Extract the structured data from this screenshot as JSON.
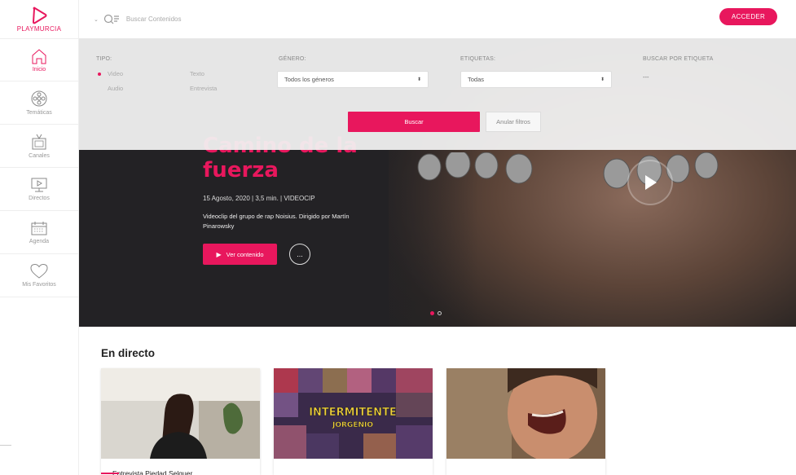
{
  "app": {
    "logo_text": "PLAYMURCIA",
    "brand_color": "#e8175d"
  },
  "sidebar": {
    "items": [
      {
        "label": "Inicio",
        "icon": "home-icon",
        "active": true
      },
      {
        "label": "Temáticas",
        "icon": "film-reel-icon",
        "active": false
      },
      {
        "label": "Canales",
        "icon": "tv-icon",
        "active": false
      },
      {
        "label": "Directos",
        "icon": "live-screen-icon",
        "active": false
      },
      {
        "label": "Agenda",
        "icon": "calendar-icon",
        "active": false
      },
      {
        "label": "Mis Favoritos",
        "icon": "heart-icon",
        "active": false
      }
    ]
  },
  "topbar": {
    "search_placeholder": "Buscar Contenidos",
    "login_label": "ACCEDER"
  },
  "filters": {
    "type_label": "TIPO:",
    "types": [
      {
        "label": "Video",
        "selected": true
      },
      {
        "label": "Texto",
        "selected": false
      },
      {
        "label": "Audio",
        "selected": false
      },
      {
        "label": "Entrevista",
        "selected": false
      }
    ],
    "genre_label": "GÉNERO:",
    "genre_value": "Todos los géneros",
    "tags_label": "ETIQUETAS:",
    "tags_value": "Todas",
    "search_by_tag_label": "BUSCAR POR ETIQUETA",
    "search_by_tag_value": "---",
    "search_button": "Buscar",
    "reset_button": "Anular filtros"
  },
  "hero": {
    "title_line1": "Camino de la",
    "title_line2": "fuerza",
    "meta": "15 Agosto, 2020  |  3,5 min.  |  VIDEOCIP",
    "description": "Videoclip del grupo de rap Noisius. Dirigido por Martín Pinarowsky",
    "view_button": "Ver contenido",
    "more_button": "...",
    "slides": 2,
    "active_slide": 1
  },
  "live": {
    "section_title": "En directo",
    "cards": [
      {
        "caption": "Entrevista Piedad Selquer",
        "thumb": "interview-woman"
      },
      {
        "caption": "",
        "thumb": "intermitente-poster"
      },
      {
        "caption": "",
        "thumb": "screaming-man"
      }
    ],
    "poster_text_1": "INTERMITENTE",
    "poster_text_2": "JORGENIO"
  }
}
